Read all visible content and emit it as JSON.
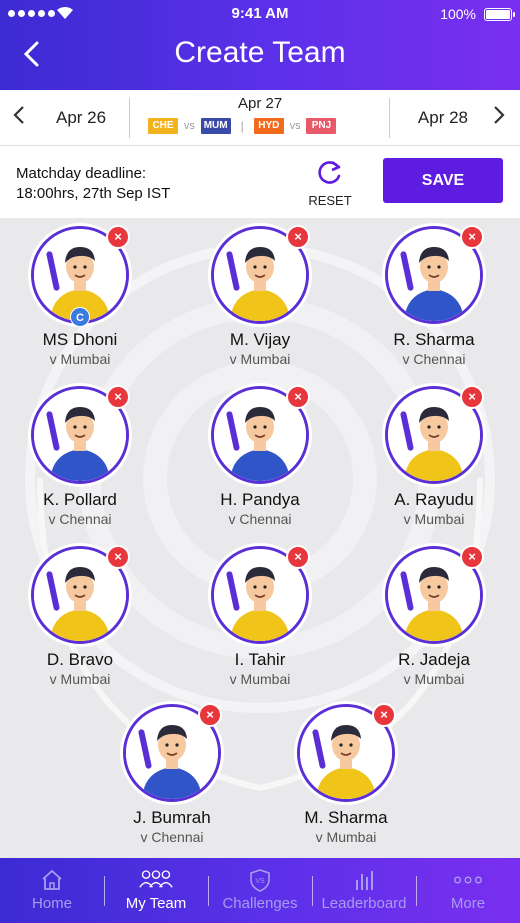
{
  "status_bar": {
    "time": "9:41 AM",
    "battery": "100%"
  },
  "header": {
    "title": "Create Team"
  },
  "date_bar": {
    "prev_day": "Apr 26",
    "current_day": "Apr 27",
    "next_day": "Apr 28",
    "matches": [
      {
        "home": "CHE",
        "vs": "VS",
        "away": "MUM",
        "home_color": "#f3b11b",
        "away_color": "#3a4aa8"
      },
      {
        "home": "HYD",
        "vs": "VS",
        "away": "PNJ",
        "home_color": "#f26a1b",
        "away_color": "#e8596a"
      }
    ],
    "separator": "|"
  },
  "deadline": {
    "line1": "Matchday deadline:",
    "line2": "18:00hrs, 27th Sep IST"
  },
  "actions": {
    "reset_label": "RESET",
    "save_label": "SAVE"
  },
  "players": [
    {
      "name": "MS Dhoni",
      "opponent": "v Mumbai",
      "jersey": "yellow",
      "captain": "C"
    },
    {
      "name": "M. Vijay",
      "opponent": "v Mumbai",
      "jersey": "yellow"
    },
    {
      "name": "R. Sharma",
      "opponent": "v Chennai",
      "jersey": "blue"
    },
    {
      "name": "K. Pollard",
      "opponent": "v Chennai",
      "jersey": "blue"
    },
    {
      "name": "H. Pandya",
      "opponent": "v Chennai",
      "jersey": "blue"
    },
    {
      "name": "A. Rayudu",
      "opponent": "v Mumbai",
      "jersey": "yellow"
    },
    {
      "name": "D. Bravo",
      "opponent": "v Mumbai",
      "jersey": "yellow"
    },
    {
      "name": "I. Tahir",
      "opponent": "v Mumbai",
      "jersey": "yellow"
    },
    {
      "name": "R. Jadeja",
      "opponent": "v Mumbai",
      "jersey": "yellow"
    },
    {
      "name": "J. Bumrah",
      "opponent": "v Chennai",
      "jersey": "blue"
    },
    {
      "name": "M. Sharma",
      "opponent": "v Mumbai",
      "jersey": "yellow"
    }
  ],
  "remove_icon": "×",
  "nav": [
    {
      "label": "Home",
      "icon": "home-icon"
    },
    {
      "label": "My Team",
      "icon": "team-icon",
      "active": true
    },
    {
      "label": "Challenges",
      "icon": "shield-vs-icon"
    },
    {
      "label": "Leaderboard",
      "icon": "bar-chart-icon"
    },
    {
      "label": "More",
      "icon": "more-icon"
    }
  ],
  "colors": {
    "accent": "#5e1ce0",
    "header_start": "#3c2bd3",
    "header_end": "#7a2ff0",
    "remove": "#e8373c",
    "captain": "#3b7ae0"
  }
}
